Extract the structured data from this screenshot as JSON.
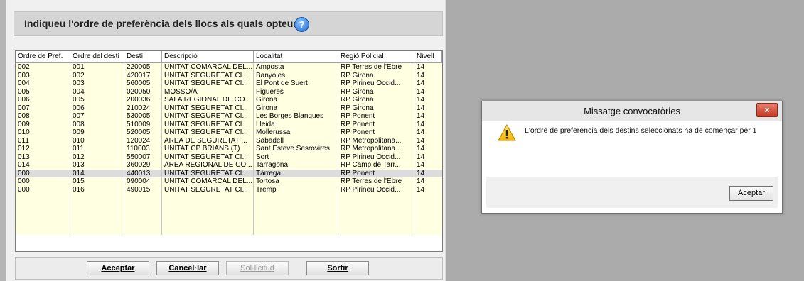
{
  "form": {
    "title": "Indiqueu l'ordre de preferència dels llocs als quals opteu:",
    "help_icon": "?",
    "columns": [
      "Ordre de Pref.",
      "Ordre del destí",
      "Destí",
      "Descripció",
      "Localitat",
      "Regió Policial",
      "Nivell"
    ],
    "rows": [
      [
        "002",
        "001",
        "220005",
        "UNITAT COMARCAL DEL...",
        "Amposta",
        "RP Terres de l'Ebre",
        "14"
      ],
      [
        "003",
        "002",
        "420017",
        "UNITAT SEGURETAT CI...",
        "Banyoles",
        "RP Girona",
        "14"
      ],
      [
        "004",
        "003",
        "560005",
        "UNITAT SEGURETAT CI...",
        "El  Pont de Suert",
        "RP Pirineu Occid...",
        "14"
      ],
      [
        "005",
        "004",
        "020050",
        "MOSSO/A",
        "Figueres",
        "RP Girona",
        "14"
      ],
      [
        "006",
        "005",
        "200036",
        "SALA REGIONAL DE CO...",
        "Girona",
        "RP Girona",
        "14"
      ],
      [
        "007",
        "006",
        "210024",
        "UNITAT SEGURETAT CI...",
        "Girona",
        "RP Girona",
        "14"
      ],
      [
        "008",
        "007",
        "530005",
        "UNITAT SEGURETAT CI...",
        "Les  Borges Blanques",
        "RP Ponent",
        "14"
      ],
      [
        "009",
        "008",
        "510009",
        "UNITAT SEGURETAT CI...",
        "Lleida",
        "RP Ponent",
        "14"
      ],
      [
        "010",
        "009",
        "520005",
        "UNITAT SEGURETAT CI...",
        "Mollerussa",
        "RP Ponent",
        "14"
      ],
      [
        "011",
        "010",
        "120024",
        "ÀREA DE SEGURETAT ...",
        "Sabadell",
        "RP  Metropolitana...",
        "14"
      ],
      [
        "012",
        "011",
        "110003",
        "UNITAT CP BRIANS (T)",
        "Sant Esteve Sesrovires",
        "RP Metropolitana ...",
        "14"
      ],
      [
        "013",
        "012",
        "550007",
        "UNITAT SEGURETAT CI...",
        "Sort",
        "RP Pirineu Occid...",
        "14"
      ],
      [
        "014",
        "013",
        "360029",
        "ÀREA REGIONAL DE CO...",
        "Tarragona",
        "RP Camp de Tarr...",
        "14"
      ],
      [
        "000",
        "014",
        "440013",
        "UNITAT SEGURETAT CI...",
        "Tàrrega",
        "RP Ponent",
        "14"
      ],
      [
        "000",
        "015",
        "090004",
        "UNITAT COMARCAL DEL...",
        "Tortosa",
        "RP Terres de l'Ebre",
        "14"
      ],
      [
        "000",
        "016",
        "490015",
        "UNITAT SEGURETAT CI...",
        "Tremp",
        "RP Pirineu Occid...",
        "14"
      ]
    ],
    "selected_row_index": 13,
    "empty_rows": 5
  },
  "buttons": {
    "accept": "Acceptar",
    "cancel": "Cancel·lar",
    "request": "Sol·licitud",
    "exit": "Sortir"
  },
  "dialog": {
    "title": "Missatge convocatòries",
    "close": "x",
    "message": "L'ordre de preferència dels destins seleccionats ha de començar per 1",
    "ok": "Aceptar",
    "icon": "warning-icon"
  },
  "colors": {
    "row_background": "#ffffe1",
    "selected_row": "#dcdcdc",
    "desktop": "#ababab"
  }
}
